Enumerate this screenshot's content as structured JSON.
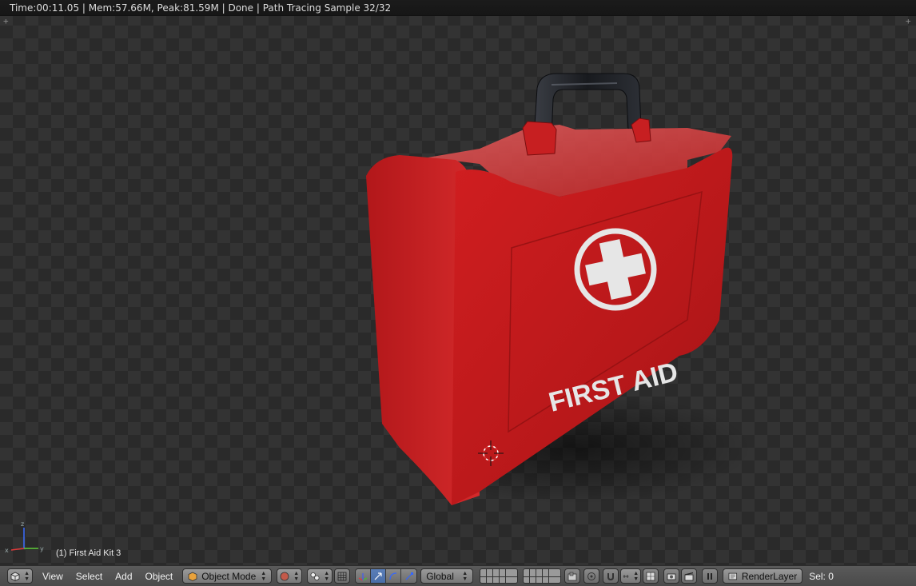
{
  "status_bar": {
    "text": "Time:00:11.05 | Mem:57.66M, Peak:81.59M | Done | Path Tracing Sample 32/32"
  },
  "viewport": {
    "object_label": "(1) First Aid Kit 3",
    "kit_text": "FIRST AID",
    "colors": {
      "kit_red": "#c0181a",
      "kit_handle": "#1e2024",
      "emblem": "#e8e8e8"
    }
  },
  "header": {
    "menus": [
      "View",
      "Select",
      "Add",
      "Object"
    ],
    "mode": "Object Mode",
    "orientation": "Global",
    "render_layer": "RenderLayer",
    "selection": "Sel: 0"
  }
}
